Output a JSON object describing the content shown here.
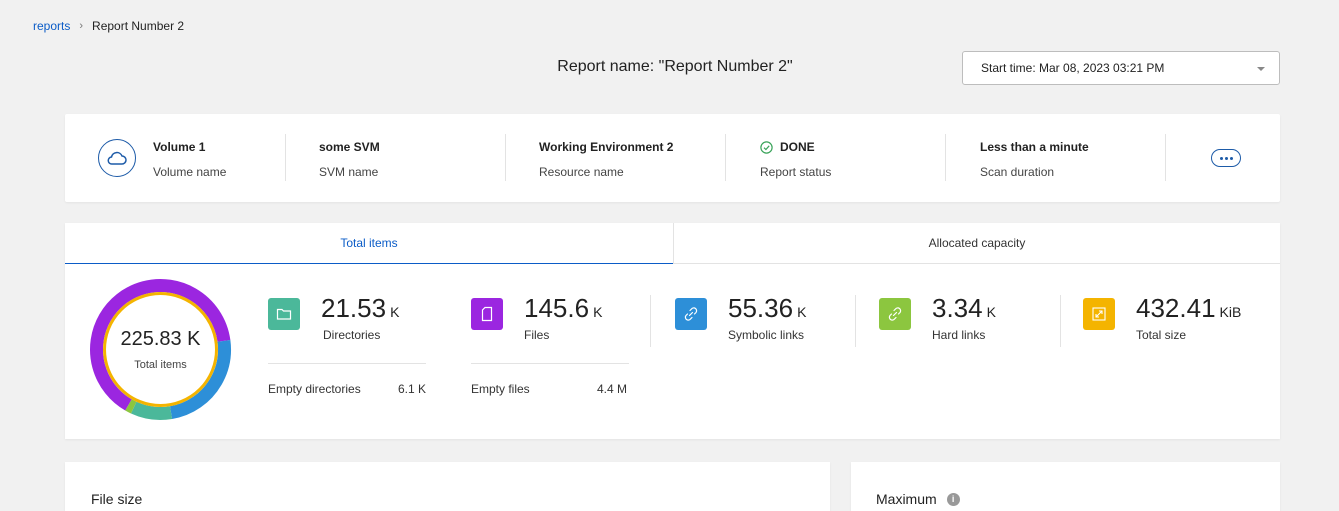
{
  "breadcrumb": {
    "root": "reports",
    "separator": "›",
    "current": "Report Number 2"
  },
  "report": {
    "title": "Report name: \"Report Number 2\""
  },
  "start_time": {
    "value": "Start time: Mar 08, 2023 03:21 PM"
  },
  "info": {
    "icon": "cloud-icon",
    "volume": {
      "value": "Volume 1",
      "label": "Volume name"
    },
    "svm": {
      "value": "some SVM",
      "label": "SVM name"
    },
    "resource": {
      "value": "Working Environment 2",
      "label": "Resource name"
    },
    "status": {
      "value": "DONE",
      "label": "Report status",
      "color": "#3aa35a"
    },
    "duration": {
      "value": "Less than a minute",
      "label": "Scan duration"
    }
  },
  "tabs": [
    {
      "label": "Total items",
      "active": true
    },
    {
      "label": "Allocated capacity",
      "active": false
    }
  ],
  "total": {
    "value": "225.83 K",
    "label": "Total items"
  },
  "donut_segments": [
    {
      "name": "Files",
      "fraction": 0.645,
      "color": "#9b26e0"
    },
    {
      "name": "Symbolic links",
      "fraction": 0.245,
      "color": "#2d8fd8"
    },
    {
      "name": "Directories",
      "fraction": 0.095,
      "color": "#4bb89a"
    },
    {
      "name": "Hard links",
      "fraction": 0.015,
      "color": "#8cc63f"
    }
  ],
  "donut_inner_color": "#f4b400",
  "stats": {
    "directories": {
      "value": "21.53",
      "unit": "K",
      "label": "Directories",
      "color": "#4bb89a",
      "icon": "folder-icon"
    },
    "files": {
      "value": "145.6",
      "unit": "K",
      "label": "Files",
      "color": "#9b26e0",
      "icon": "file-icon"
    },
    "symlinks": {
      "value": "55.36",
      "unit": "K",
      "label": "Symbolic links",
      "color": "#2d8fd8",
      "icon": "link-icon"
    },
    "hardlinks": {
      "value": "3.34",
      "unit": "K",
      "label": "Hard links",
      "color": "#8cc63f",
      "icon": "link-icon"
    },
    "totalsize": {
      "value": "432.41",
      "unit": "KiB",
      "label": "Total size",
      "color": "#f4b400",
      "icon": "expand-icon"
    }
  },
  "empty": {
    "directories": {
      "label": "Empty directories",
      "value": "6.1 K"
    },
    "files": {
      "label": "Empty files",
      "value": "4.4 M"
    }
  },
  "bottom": {
    "file_size": "File size",
    "maximum": "Maximum",
    "info_glyph": "i"
  }
}
